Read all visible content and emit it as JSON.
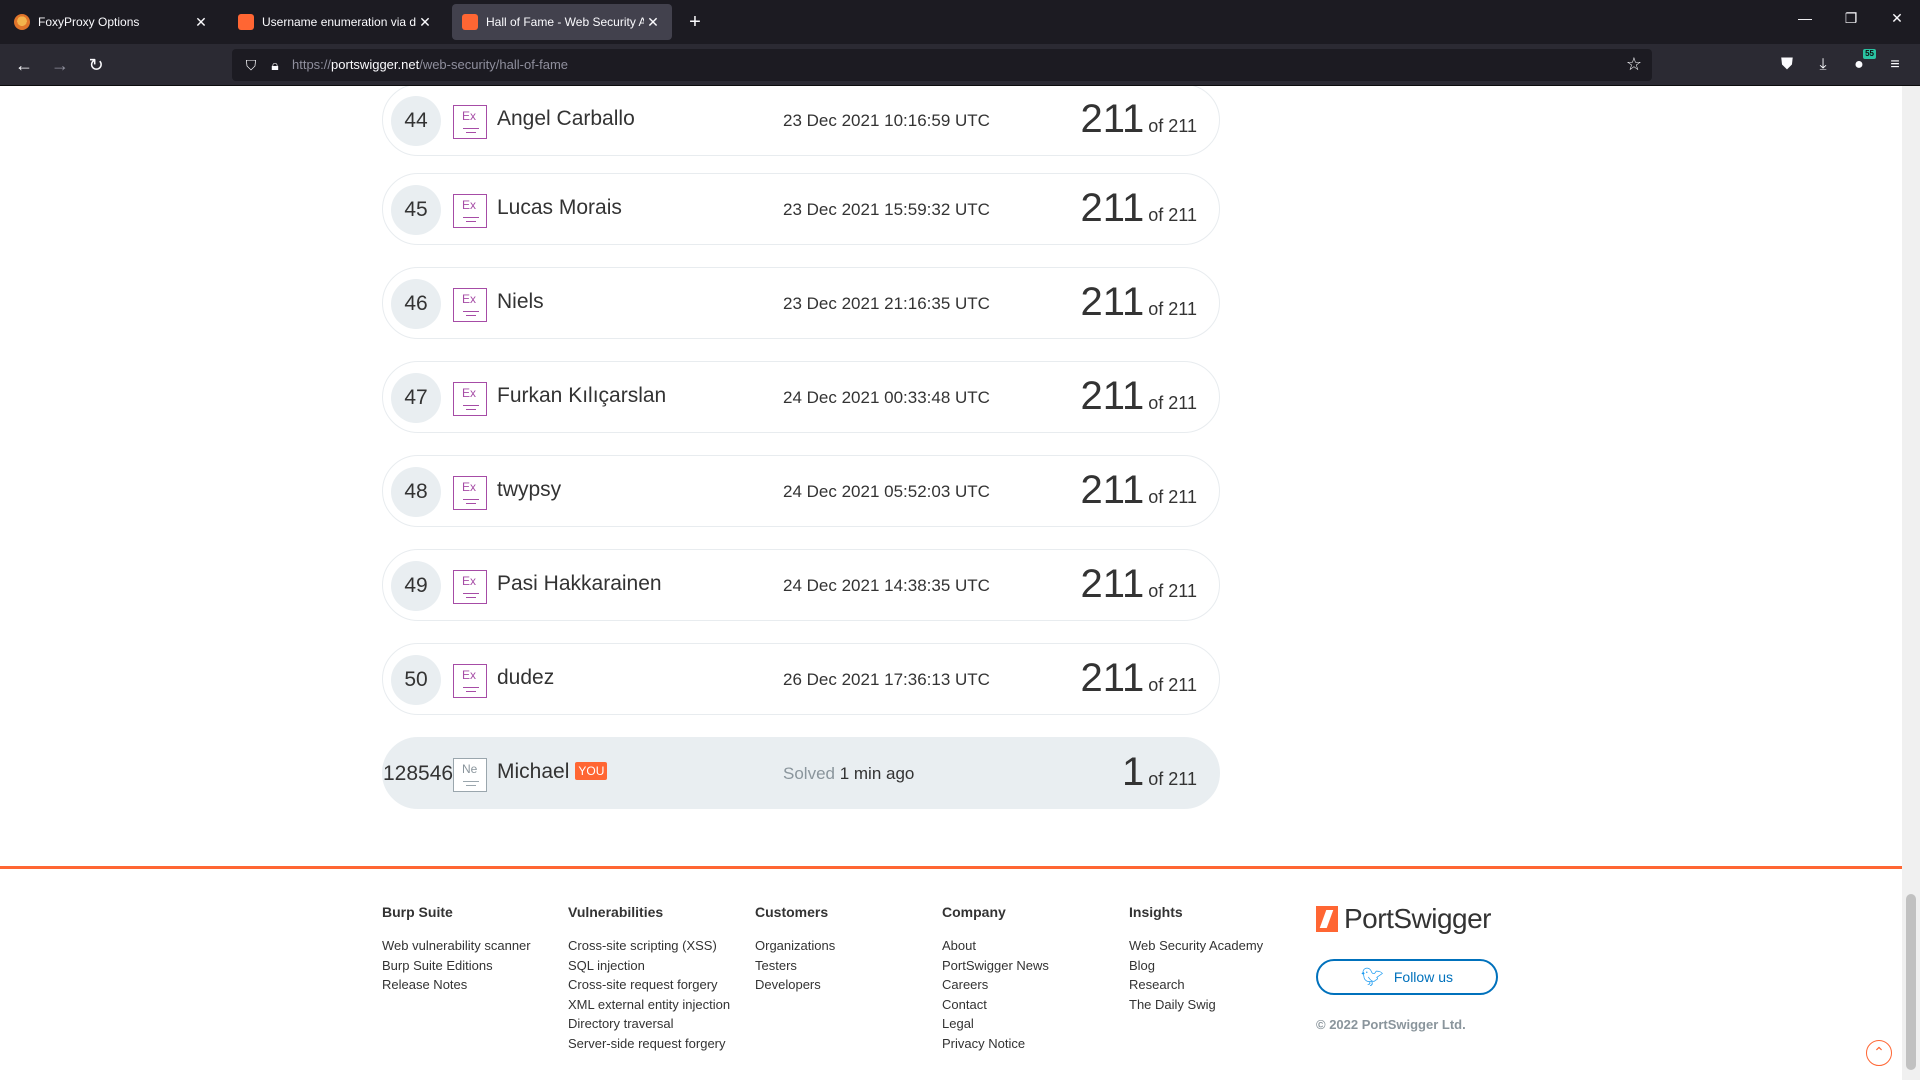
{
  "browser": {
    "tabs": [
      {
        "title": "FoxyProxy Options",
        "active": false
      },
      {
        "title": "Username enumeration via diffe",
        "active": false
      },
      {
        "title": "Hall of Fame - Web Security Ac",
        "active": true
      }
    ],
    "new_tab_glyph": "+",
    "url_prefix": "https://",
    "url_host": "portswigger.net",
    "url_path": "/web-security/hall-of-fame",
    "extension_badge": "55"
  },
  "rows": [
    {
      "rank": "44",
      "badge": "Ex",
      "name": "Angel Carballo",
      "date": "23 Dec 2021 10:16:59 UTC",
      "solved": "211",
      "of": "of 211"
    },
    {
      "rank": "45",
      "badge": "Ex",
      "name": "Lucas Morais",
      "date": "23 Dec 2021 15:59:32 UTC",
      "solved": "211",
      "of": "of 211"
    },
    {
      "rank": "46",
      "badge": "Ex",
      "name": "Niels",
      "date": "23 Dec 2021 21:16:35 UTC",
      "solved": "211",
      "of": "of 211"
    },
    {
      "rank": "47",
      "badge": "Ex",
      "name": "Furkan Kılıçarslan",
      "date": "24 Dec 2021 00:33:48 UTC",
      "solved": "211",
      "of": "of 211"
    },
    {
      "rank": "48",
      "badge": "Ex",
      "name": "twypsy",
      "date": "24 Dec 2021 05:52:03 UTC",
      "solved": "211",
      "of": "of 211"
    },
    {
      "rank": "49",
      "badge": "Ex",
      "name": "Pasi Hakkarainen",
      "date": "24 Dec 2021 14:38:35 UTC",
      "solved": "211",
      "of": "of 211"
    },
    {
      "rank": "50",
      "badge": "Ex",
      "name": "dudez",
      "date": "26 Dec 2021 17:36:13 UTC",
      "solved": "211",
      "of": "of 211"
    }
  ],
  "me": {
    "rank": "128546",
    "badge": "Ne",
    "name": "Michael",
    "you": "YOU",
    "solved_prefix": "Solved",
    "solved_when": "1 min ago",
    "solved": "1",
    "of": "of 211"
  },
  "footer": {
    "columns": [
      {
        "heading": "Burp Suite",
        "links": [
          "Web vulnerability scanner",
          "Burp Suite Editions",
          "Release Notes"
        ]
      },
      {
        "heading": "Vulnerabilities",
        "links": [
          "Cross-site scripting (XSS)",
          "SQL injection",
          "Cross-site request forgery",
          "XML external entity injection",
          "Directory traversal",
          "Server-side request forgery"
        ]
      },
      {
        "heading": "Customers",
        "links": [
          "Organizations",
          "Testers",
          "Developers"
        ]
      },
      {
        "heading": "Company",
        "links": [
          "About",
          "PortSwigger News",
          "Careers",
          "Contact",
          "Legal",
          "Privacy Notice"
        ]
      },
      {
        "heading": "Insights",
        "links": [
          "Web Security Academy",
          "Blog",
          "Research",
          "The Daily Swig"
        ]
      }
    ],
    "logo_text": "PortSwigger",
    "follow_label": "Follow us",
    "copyright": "© 2022 PortSwigger Ltd."
  },
  "colors": {
    "accent": "#ff6633",
    "badge_expert": "#a64ca6",
    "link_blue": "#0071bc"
  }
}
